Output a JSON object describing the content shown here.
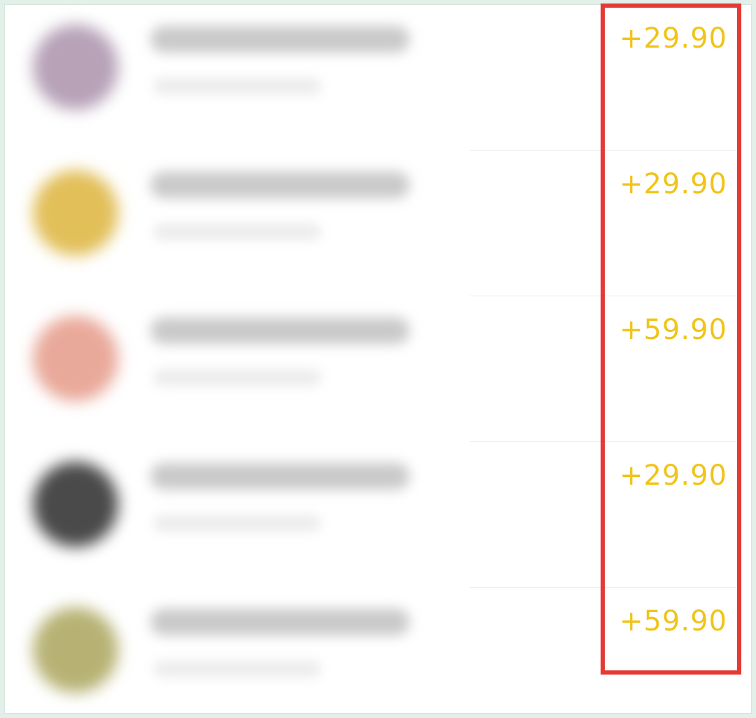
{
  "colors": {
    "amount": "#f0c419",
    "highlight": "#e53935",
    "background": "#e3efe9",
    "panel": "#ffffff"
  },
  "transactions": [
    {
      "amount": "+29.90",
      "avatar_color": "#b7a2b8"
    },
    {
      "amount": "+29.90",
      "avatar_color": "#e2bf59"
    },
    {
      "amount": "+59.90",
      "avatar_color": "#e9a99a"
    },
    {
      "amount": "+29.90",
      "avatar_color": "#4a4a4a"
    },
    {
      "amount": "+59.90",
      "avatar_color": "#b7b274"
    }
  ]
}
